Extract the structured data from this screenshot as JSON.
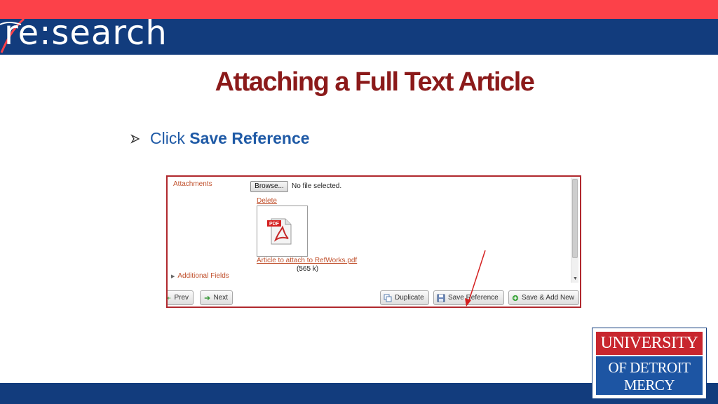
{
  "header": {
    "logo_text": "re:search"
  },
  "slide": {
    "title": "Attaching a Full Text Article",
    "bullet_prefix": "Click",
    "bullet_emphasis": "Save Reference"
  },
  "form": {
    "attachments_label": "Attachments",
    "browse_label": "Browse...",
    "no_file_text": "No file selected.",
    "delete_label": "Delete",
    "file_name": "Article to attach to RefWorks.pdf",
    "file_size": "(565 k)",
    "additional_fields_label": "Additional Fields"
  },
  "buttons": {
    "prev_label": "Prev",
    "next_label": "Next",
    "duplicate_label": "Duplicate",
    "save_reference_label": "Save Reference",
    "save_add_new_label": "Save & Add New"
  },
  "university_logo": {
    "line1": "UNIVERSITY",
    "line2": "OF DETROIT",
    "line3": "MERCY"
  },
  "colors": {
    "top_stripe": "#fc4149",
    "header_band": "#123c7d",
    "title": "#8b1a1a",
    "bullet_text": "#1f5aa6",
    "link_orange": "#c0502c",
    "callout_arrow": "#d42020"
  }
}
